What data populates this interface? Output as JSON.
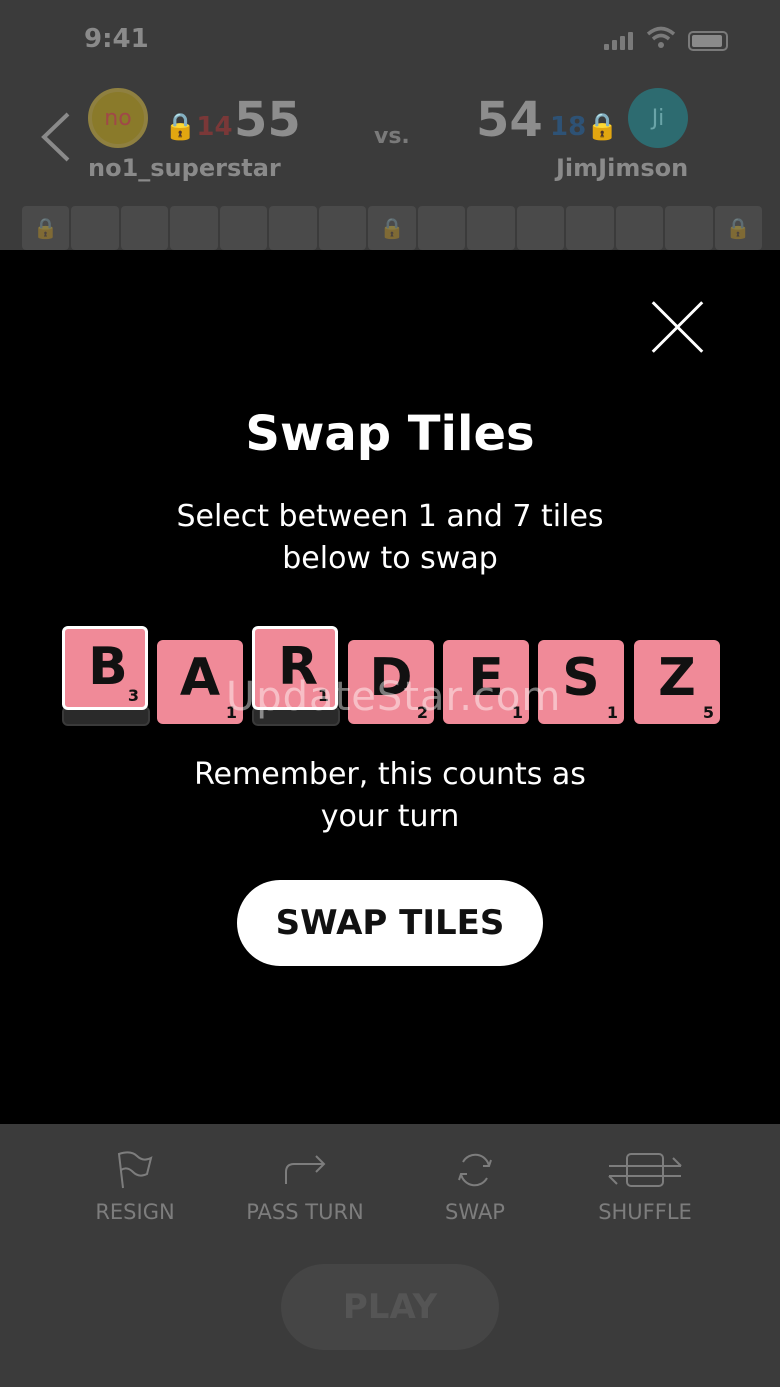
{
  "status": {
    "time": "9:41"
  },
  "header": {
    "left_player": {
      "avatar": "no",
      "name": "no1_superstar",
      "lock_count": "14",
      "score": "55"
    },
    "vs": "vs.",
    "right_player": {
      "avatar": "Ji",
      "name": "JimJimson",
      "lock_count": "18",
      "score": "54"
    }
  },
  "modal": {
    "title": "Swap Tiles",
    "subtitle": "Select between 1 and 7 tiles below to swap",
    "tiles": [
      {
        "letter": "B",
        "points": "3",
        "selected": true
      },
      {
        "letter": "A",
        "points": "1",
        "selected": false
      },
      {
        "letter": "R",
        "points": "1",
        "selected": true
      },
      {
        "letter": "D",
        "points": "2",
        "selected": false
      },
      {
        "letter": "E",
        "points": "1",
        "selected": false
      },
      {
        "letter": "S",
        "points": "1",
        "selected": false
      },
      {
        "letter": "Z",
        "points": "5",
        "selected": false
      }
    ],
    "watermark": "UpdateStar.com",
    "remember": "Remember, this counts as your turn",
    "swap_button": "SWAP TILES"
  },
  "toolbar": {
    "resign": "RESIGN",
    "pass_turn": "PASS TURN",
    "swap": "SWAP",
    "shuffle": "SHUFFLE",
    "play": "PLAY"
  },
  "colors": {
    "tile": "#f08a98",
    "modal_bg": "#000000",
    "page_bg": "#3b3b3b"
  }
}
